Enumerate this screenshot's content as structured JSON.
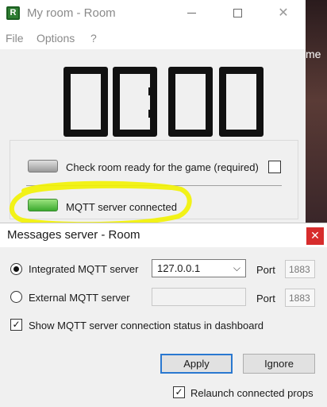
{
  "background_window": {
    "partial_text": "me"
  },
  "main_window": {
    "title": "My room - Room",
    "icon_letter": "R",
    "menu": [
      "File",
      "Options",
      "?"
    ],
    "clock": "00:00",
    "status": {
      "ready_label": "Check room ready for the game (required)",
      "ready_checked": false,
      "mqtt_label": "MQTT server connected",
      "mqtt_led": "green"
    }
  },
  "dialog": {
    "title": "Messages server - Room",
    "close_glyph": "✕",
    "integrated": {
      "label": "Integrated MQTT server",
      "selected": true,
      "address": "127.0.0.1",
      "port_label": "Port",
      "port": "1883"
    },
    "external": {
      "label": "External MQTT server",
      "selected": false,
      "address": "",
      "port_label": "Port",
      "port": "1883"
    },
    "show_status": {
      "label": "Show MQTT server connection status in dashboard",
      "checked": true
    },
    "apply_label": "Apply",
    "ignore_label": "Ignore",
    "relaunch": {
      "label": "Relaunch connected props",
      "checked": true
    }
  },
  "colors": {
    "led_green": "#3caa2f",
    "highlight": "#f2f200",
    "close_red": "#d72c2c",
    "accent": "#2a78d0"
  }
}
